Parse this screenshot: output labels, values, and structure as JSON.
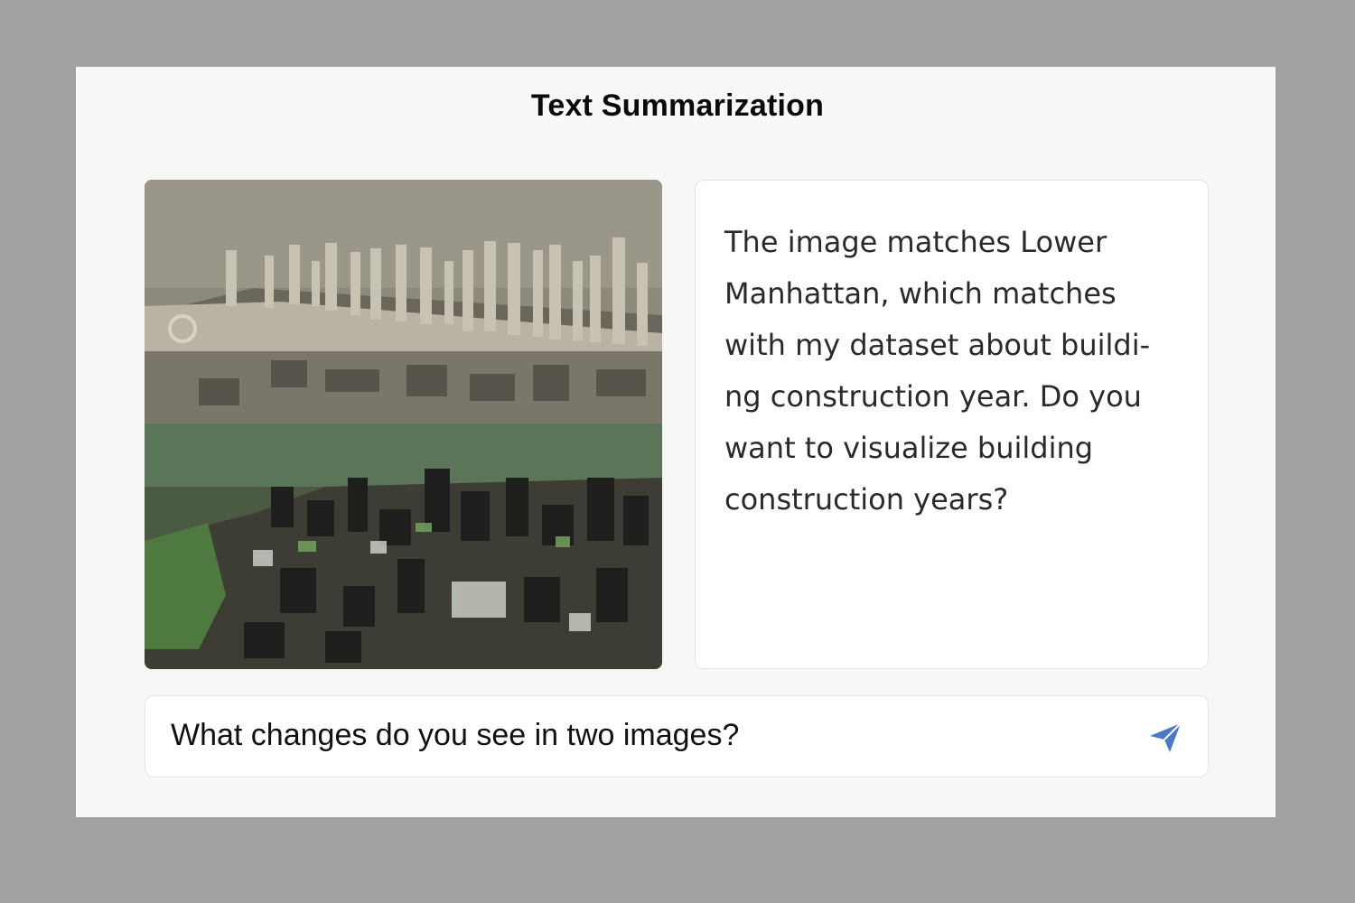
{
  "header": {
    "title": "Text Summarization"
  },
  "image_panel": {
    "top_image": "historical-aerial-photo-lower-manhattan",
    "bottom_image": "recent-satellite-photo-lower-manhattan"
  },
  "response": {
    "text": "The image matches Lower\nManhattan, which matches\nwith my dataset about buildi-\nng construction year. Do you\nwant to visualize building\nconstruction years?"
  },
  "input": {
    "value": "What changes do you see in two images?",
    "send_icon": "send-icon",
    "accent_color": "#4a78c8"
  }
}
